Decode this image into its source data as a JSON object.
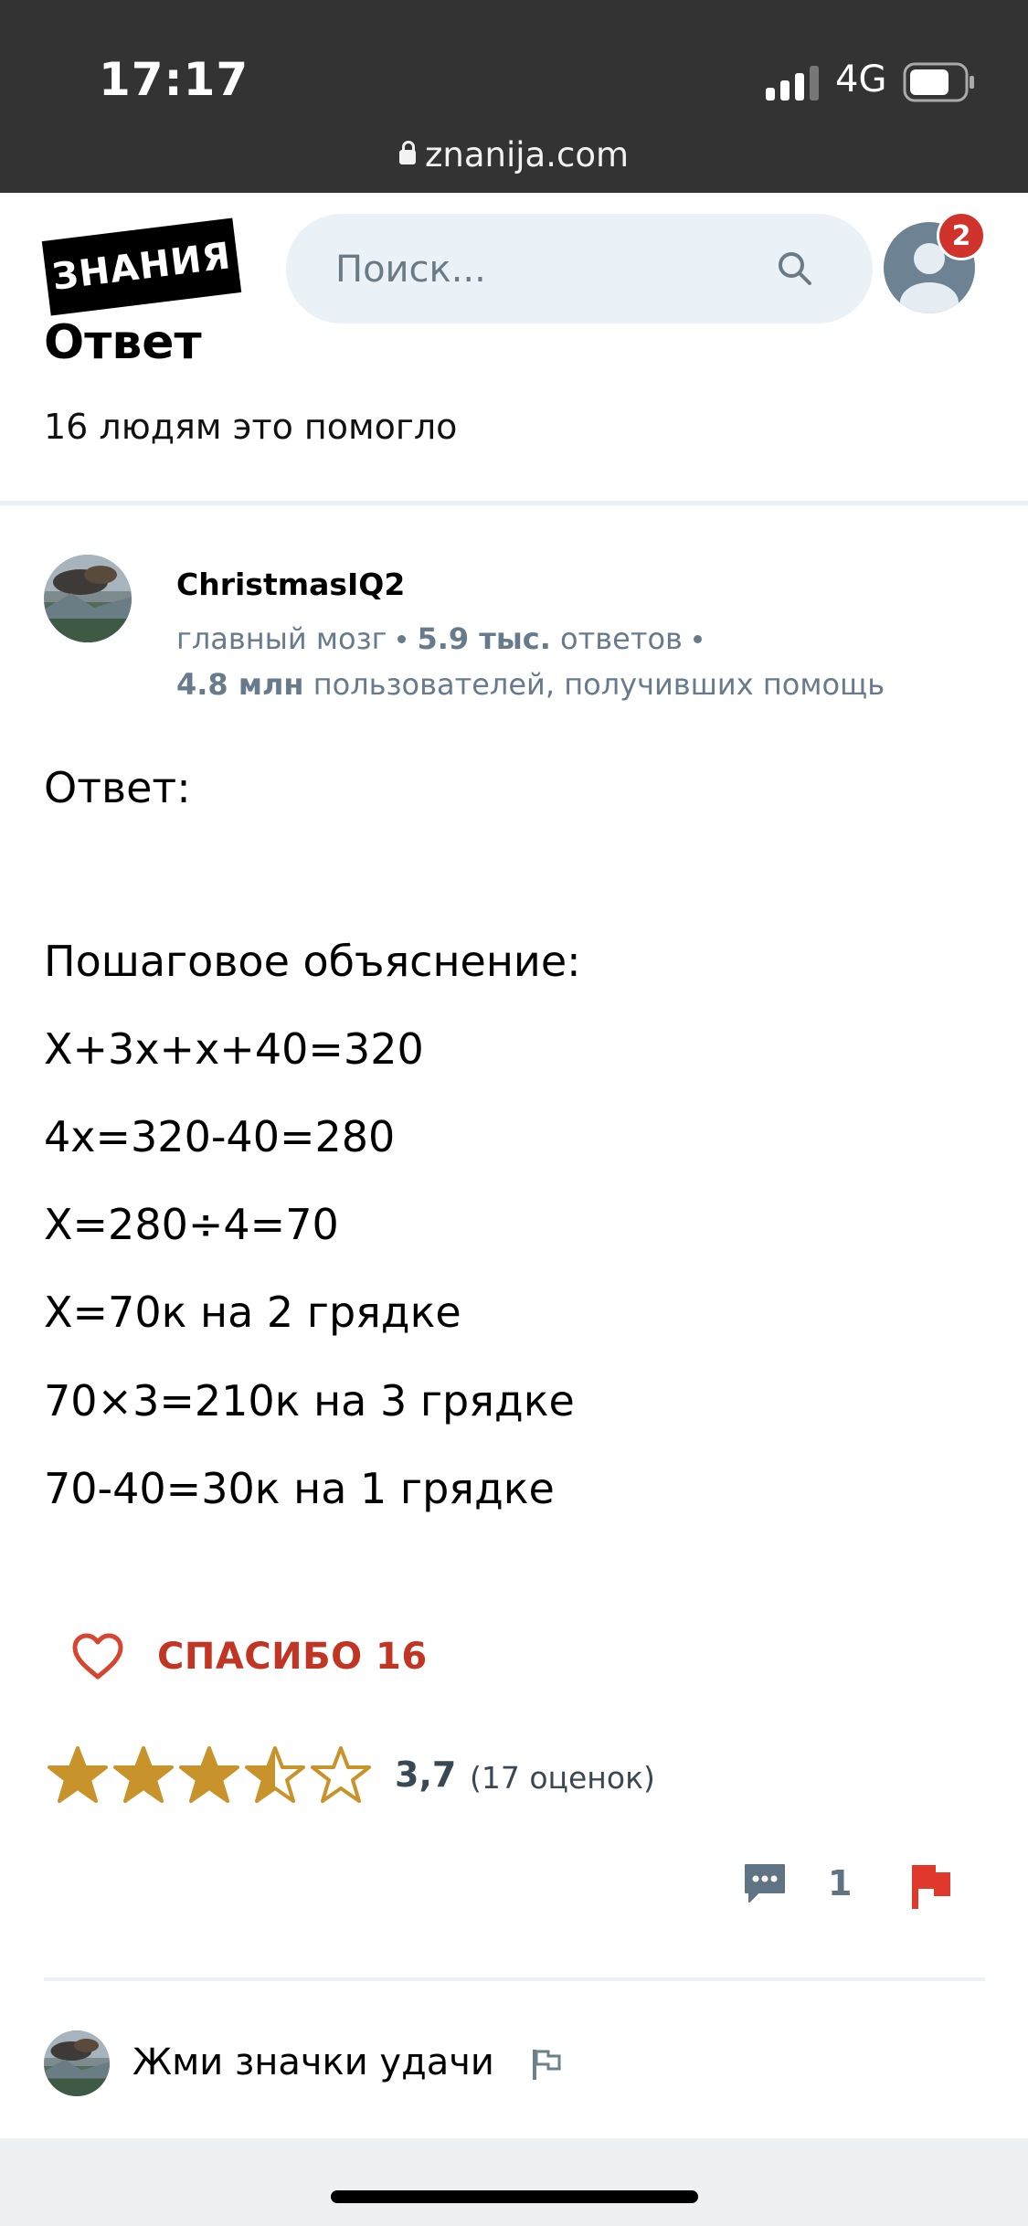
{
  "status_bar": {
    "time": "17:17",
    "network": "4G",
    "url": "znanija.com"
  },
  "header": {
    "logo_text": "ЗНАНИЯ",
    "search_placeholder": "Поиск...",
    "notification_count": "2"
  },
  "answer_section": {
    "heading": "Ответ",
    "helped_text": "16 людям это помогло"
  },
  "author": {
    "name": "ChristmasIQ2",
    "rank": "главный мозг",
    "answers_count": "5.9 тыс.",
    "answers_label": "ответов",
    "helped_count": "4.8 млн",
    "helped_label": "пользователей, получивших помощь"
  },
  "answer_body": [
    "Ответ:",
    "Пошаговое объяснение:",
    "X+3x+x+40=320",
    "4x=320-40=280",
    "X=280÷4=70",
    "X=70к на 2 грядке",
    "70×3=210к на 3 грядке",
    "70-40=30к на 1 грядке"
  ],
  "actions": {
    "thanks_label": "СПАСИБО 16",
    "rating_value": "3,7",
    "rating_count": "(17 оценок)",
    "rating_stars": 3.7,
    "comments_count": "1"
  },
  "comment": {
    "text": "Жми значки удачи"
  },
  "colors": {
    "accent_red": "#c03523",
    "star_gold": "#c8932a",
    "muted": "#687b8c"
  }
}
